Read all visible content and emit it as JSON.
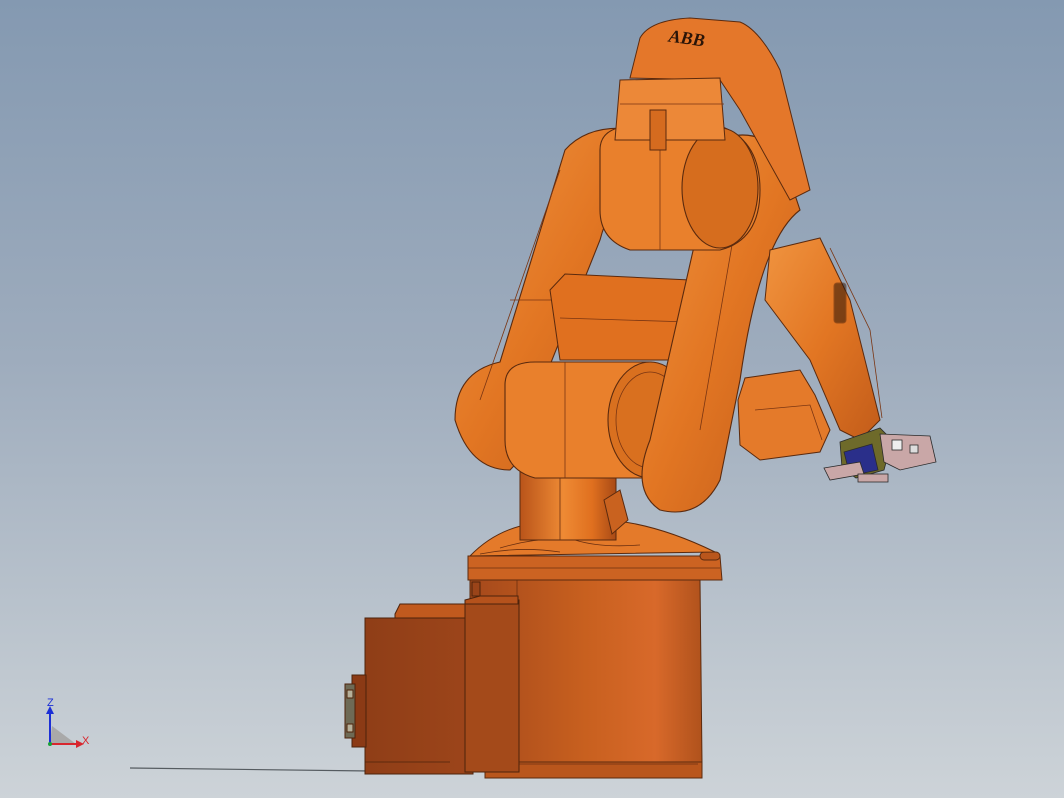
{
  "viewport": {
    "background_top": "#8499b1",
    "background_bottom": "#cdd3d8"
  },
  "model": {
    "brand_text": "ABB",
    "body_color": "#e67722",
    "body_shadow_color": "#b9541a",
    "controller_color": "#9a4419",
    "edge_color": "#5b2a0e"
  },
  "triad": {
    "z_label": "Z",
    "x_label": "X",
    "z_color": "#1c2fd6",
    "x_color": "#d8262e"
  }
}
